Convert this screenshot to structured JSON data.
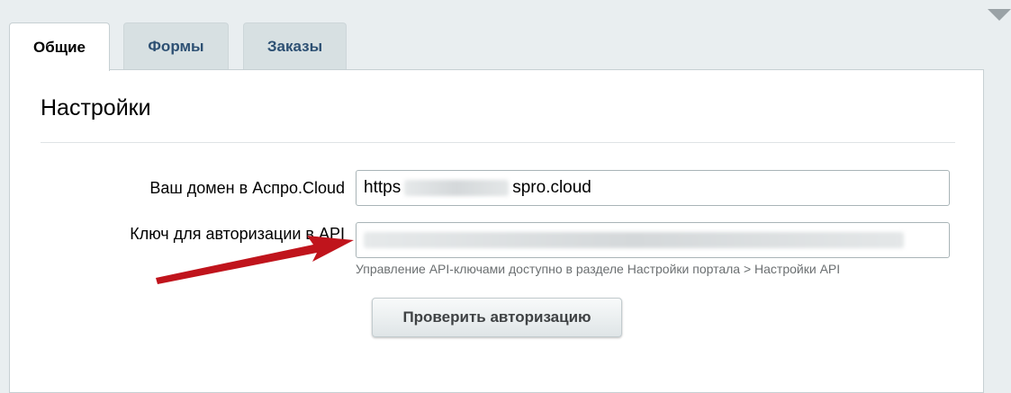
{
  "tabs": [
    {
      "label": "Общие",
      "active": true
    },
    {
      "label": "Формы",
      "active": false
    },
    {
      "label": "Заказы",
      "active": false
    }
  ],
  "section": {
    "title": "Настройки"
  },
  "fields": {
    "domain": {
      "label": "Ваш домен в Аспро.Cloud",
      "value_start": "https",
      "value_end": "spro.cloud"
    },
    "api_key": {
      "label": "Ключ для авторизации в API",
      "hint": "Управление API-ключами доступно в разделе Настройки портала > Настройки API"
    }
  },
  "buttons": {
    "check_auth": "Проверить авторизацию"
  },
  "colors": {
    "accent_tab_text": "#2d5073",
    "annotation_arrow": "#c0141c",
    "background": "#e9eef0"
  },
  "icons": {
    "corner": "triangle-down-icon",
    "annotation": "red-arrow-icon"
  }
}
